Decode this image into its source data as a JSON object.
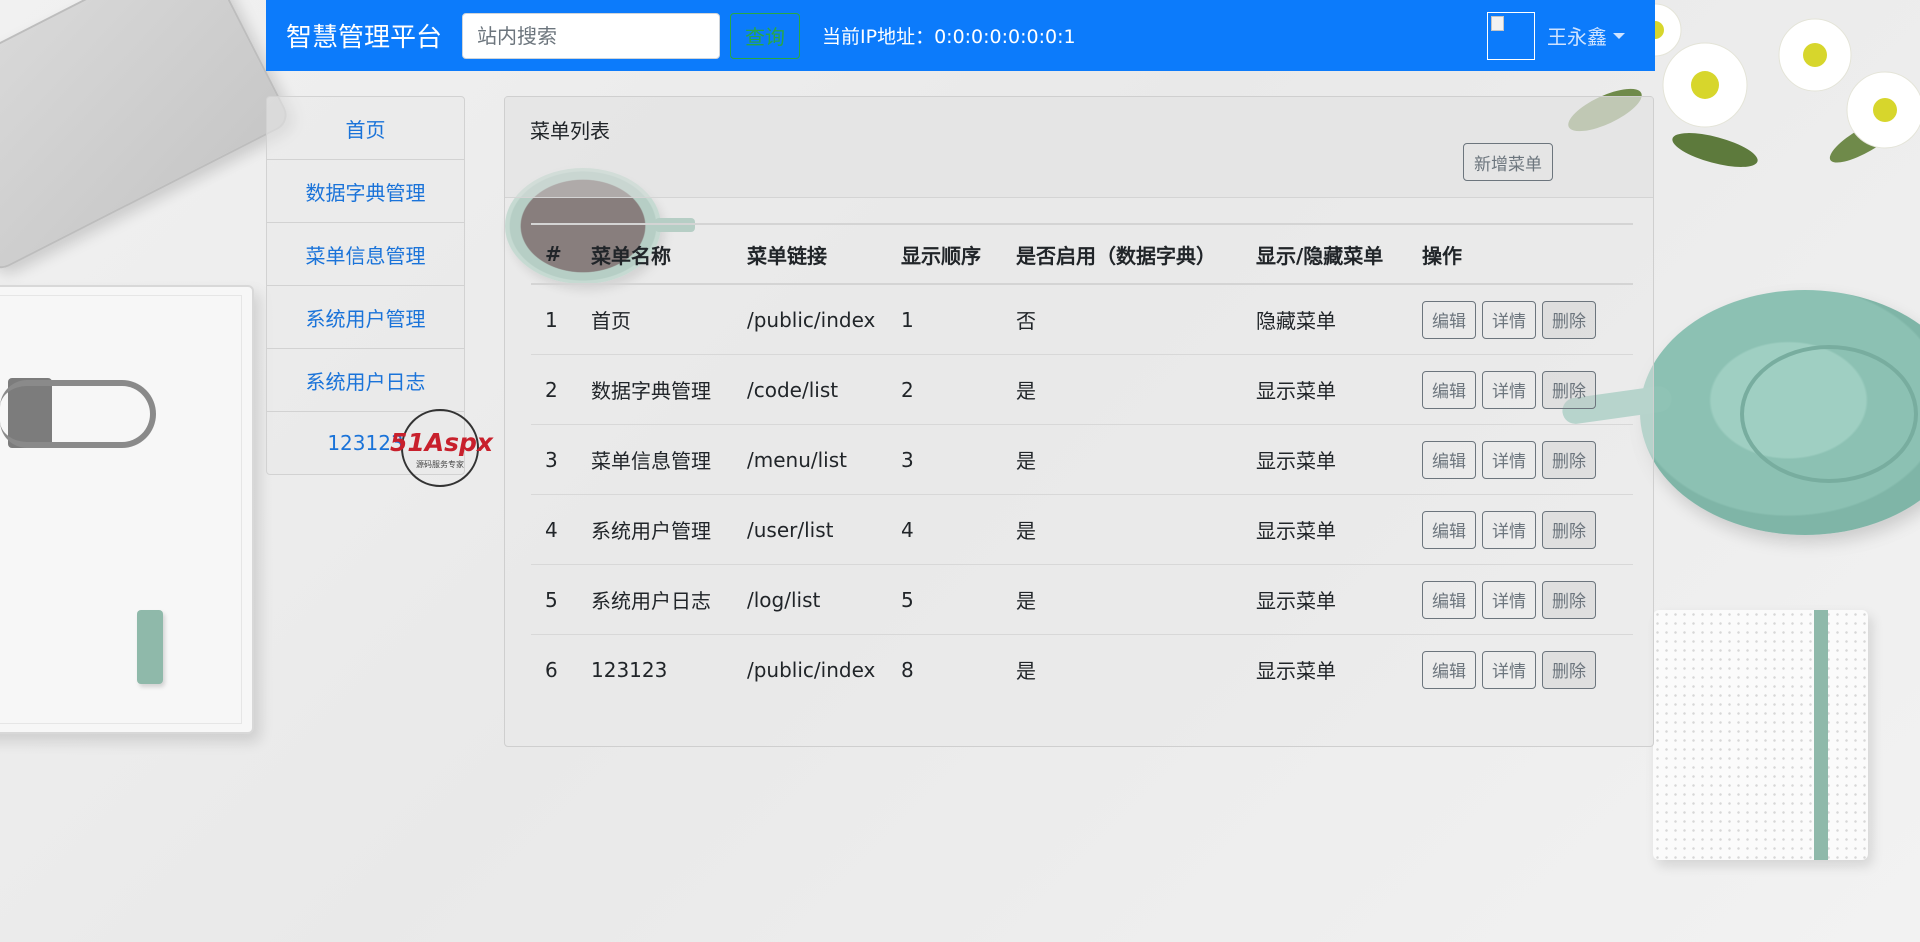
{
  "navbar": {
    "brand": "智慧管理平台",
    "search_placeholder": "站内搜索",
    "search_button": "查询",
    "ip_text": "当前IP地址：0:0:0:0:0:0:0:1",
    "username": "王永鑫",
    "brand_color": "#0c7bfb"
  },
  "sidebar": {
    "items": [
      {
        "label": "首页"
      },
      {
        "label": "数据字典管理"
      },
      {
        "label": "菜单信息管理"
      },
      {
        "label": "系统用户管理"
      },
      {
        "label": "系统用户日志"
      },
      {
        "label": "123123"
      }
    ]
  },
  "watermark": {
    "logo_text": "51Aspx",
    "tagline": "源码服务专家"
  },
  "main": {
    "title": "菜单列表",
    "add_button": "新增菜单",
    "table": {
      "columns": [
        "#",
        "菜单名称",
        "菜单链接",
        "显示顺序",
        "是否启用（数据字典）",
        "显示/隐藏菜单",
        "操作"
      ],
      "rows": [
        {
          "id": "1",
          "name": "首页",
          "link": "/public/index",
          "order": "1",
          "enabled": "否",
          "visibility": "隐藏菜单"
        },
        {
          "id": "2",
          "name": "数据字典管理",
          "link": "/code/list",
          "order": "2",
          "enabled": "是",
          "visibility": "显示菜单"
        },
        {
          "id": "3",
          "name": "菜单信息管理",
          "link": "/menu/list",
          "order": "3",
          "enabled": "是",
          "visibility": "显示菜单"
        },
        {
          "id": "4",
          "name": "系统用户管理",
          "link": "/user/list",
          "order": "4",
          "enabled": "是",
          "visibility": "显示菜单"
        },
        {
          "id": "5",
          "name": "系统用户日志",
          "link": "/log/list",
          "order": "5",
          "enabled": "是",
          "visibility": "显示菜单"
        },
        {
          "id": "6",
          "name": "123123",
          "link": "/public/index",
          "order": "8",
          "enabled": "是",
          "visibility": "显示菜单"
        }
      ],
      "actions": {
        "edit": "编辑",
        "detail": "详情",
        "delete": "删除"
      }
    }
  }
}
